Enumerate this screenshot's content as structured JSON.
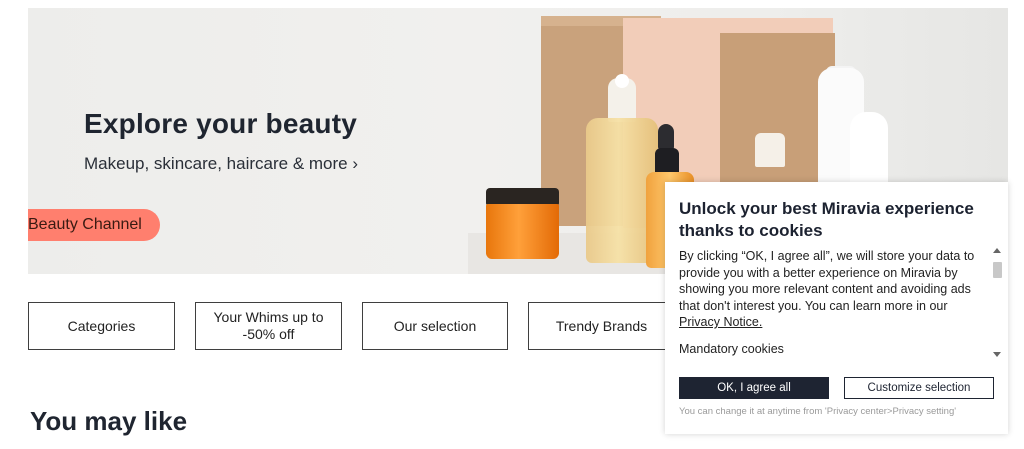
{
  "hero": {
    "title": "Explore your beauty",
    "subtitle": "Makeup, skincare, haircare & more ›",
    "cta": "Beauty Channel"
  },
  "categories": [
    {
      "label": "Categories"
    },
    {
      "label": "Your Whims up to -50% off"
    },
    {
      "label": "Our selection"
    },
    {
      "label": "Trendy Brands"
    }
  ],
  "section": {
    "title": "You may like"
  },
  "cookie_banner": {
    "title": "Unlock your best Miravia experience thanks to cookies",
    "body": "By clicking “OK, I agree all”, we will store your data to provide you with a better experience on Miravia by showing you more relevant content and avoiding ads that don't interest you. You can learn more in our",
    "privacy_link": "Privacy Notice.",
    "mandatory_heading": "Mandatory cookies",
    "agree_button": "OK, I agree all",
    "customize_button": "Customize selection",
    "note": "You can change it at anytime from 'Privacy center>Privacy setting'"
  },
  "colors": {
    "accent": "#ff7f6e",
    "button_dark": "#1e2432"
  }
}
